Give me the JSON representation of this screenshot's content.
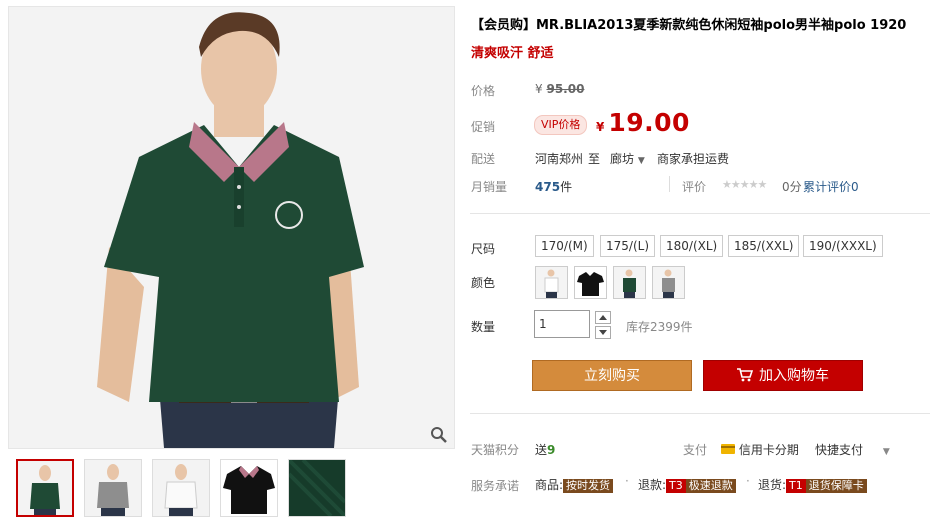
{
  "product": {
    "title": "【会员购】MR.BLIA2013夏季新款纯色休闲短袖polo男半袖polo 1920",
    "subtitle": "清爽吸汗 舒适"
  },
  "price": {
    "label": "价格",
    "currency": "¥",
    "original": "95.00"
  },
  "promo": {
    "label": "促销",
    "vip_badge": "VIP价格",
    "currency": "¥",
    "value": "19.00"
  },
  "shipping": {
    "label": "配送",
    "origin": "河南郑州",
    "to": "至",
    "destination": "廊坊",
    "fee_note": "商家承担运费"
  },
  "sales": {
    "label": "月销量",
    "count": "475",
    "unit": "件",
    "rating_label": "评价",
    "stars": "★★★★★",
    "score": "0分",
    "review_count_label": "累计评价",
    "review_count": "0"
  },
  "size": {
    "label": "尺码",
    "options": [
      "170/(M)",
      "175/(L)",
      "180/(XL)",
      "185/(XXL)",
      "190/(XXXL)"
    ]
  },
  "color": {
    "label": "颜色",
    "swatches": [
      "white",
      "black",
      "dark-green",
      "gray"
    ]
  },
  "quantity": {
    "label": "数量",
    "value": "1",
    "stock": "库存2399件"
  },
  "actions": {
    "buy_now": "立刻购买",
    "add_to_cart": "加入购物车"
  },
  "points": {
    "label": "天猫积分",
    "text": "送",
    "value": "9"
  },
  "payment": {
    "label": "支付",
    "credit": "信用卡分期",
    "quick": "快捷支付"
  },
  "service": {
    "label": "服务承诺",
    "goods_prefix": "商品:",
    "goods_badge": "按时发货",
    "refund_prefix": "退款:",
    "refund_tag": "T3",
    "refund_badge": "极速退款",
    "return_prefix": "退货:",
    "return_tag": "T1",
    "return_badge": "退货保障卡"
  },
  "colors": {
    "accent": "#c40000",
    "buy_now": "#d48b3c",
    "shirt_green": "#1f4a35"
  }
}
